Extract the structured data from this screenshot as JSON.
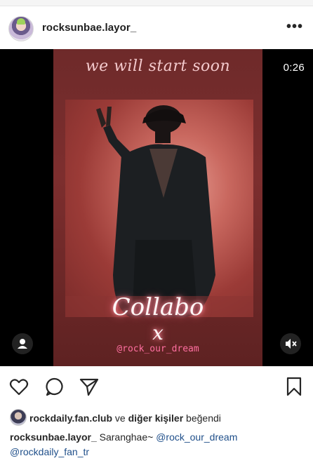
{
  "post": {
    "username": "rocksunbae.layor_",
    "more_label": "•••",
    "media": {
      "headline": "we will start soon",
      "collabo": "Collabo",
      "x_mark": "x",
      "handle": "@rock_our_dream",
      "timer": "0:26"
    },
    "likes": {
      "liker": "rockdaily.fan.club",
      "connector": " ve ",
      "others": "diğer kişiler",
      "suffix": " beğendi"
    },
    "caption": {
      "user": "rocksunbae.layor_",
      "text": " Saranghae~ ",
      "mention1": "@rock_our_dream",
      "mention2": "@rockdaily_fan_tr"
    }
  },
  "icons": {
    "avatar": "profile-avatar",
    "more": "more-options-icon",
    "user_tag": "user-tag-icon",
    "mute": "mute-icon",
    "like": "heart-icon",
    "comment": "comment-icon",
    "share": "share-icon",
    "save": "bookmark-icon"
  },
  "colors": {
    "mention": "#1f4f8a",
    "poster_bg": "#7d2e2e",
    "neon_pink": "#ff6fa0"
  }
}
